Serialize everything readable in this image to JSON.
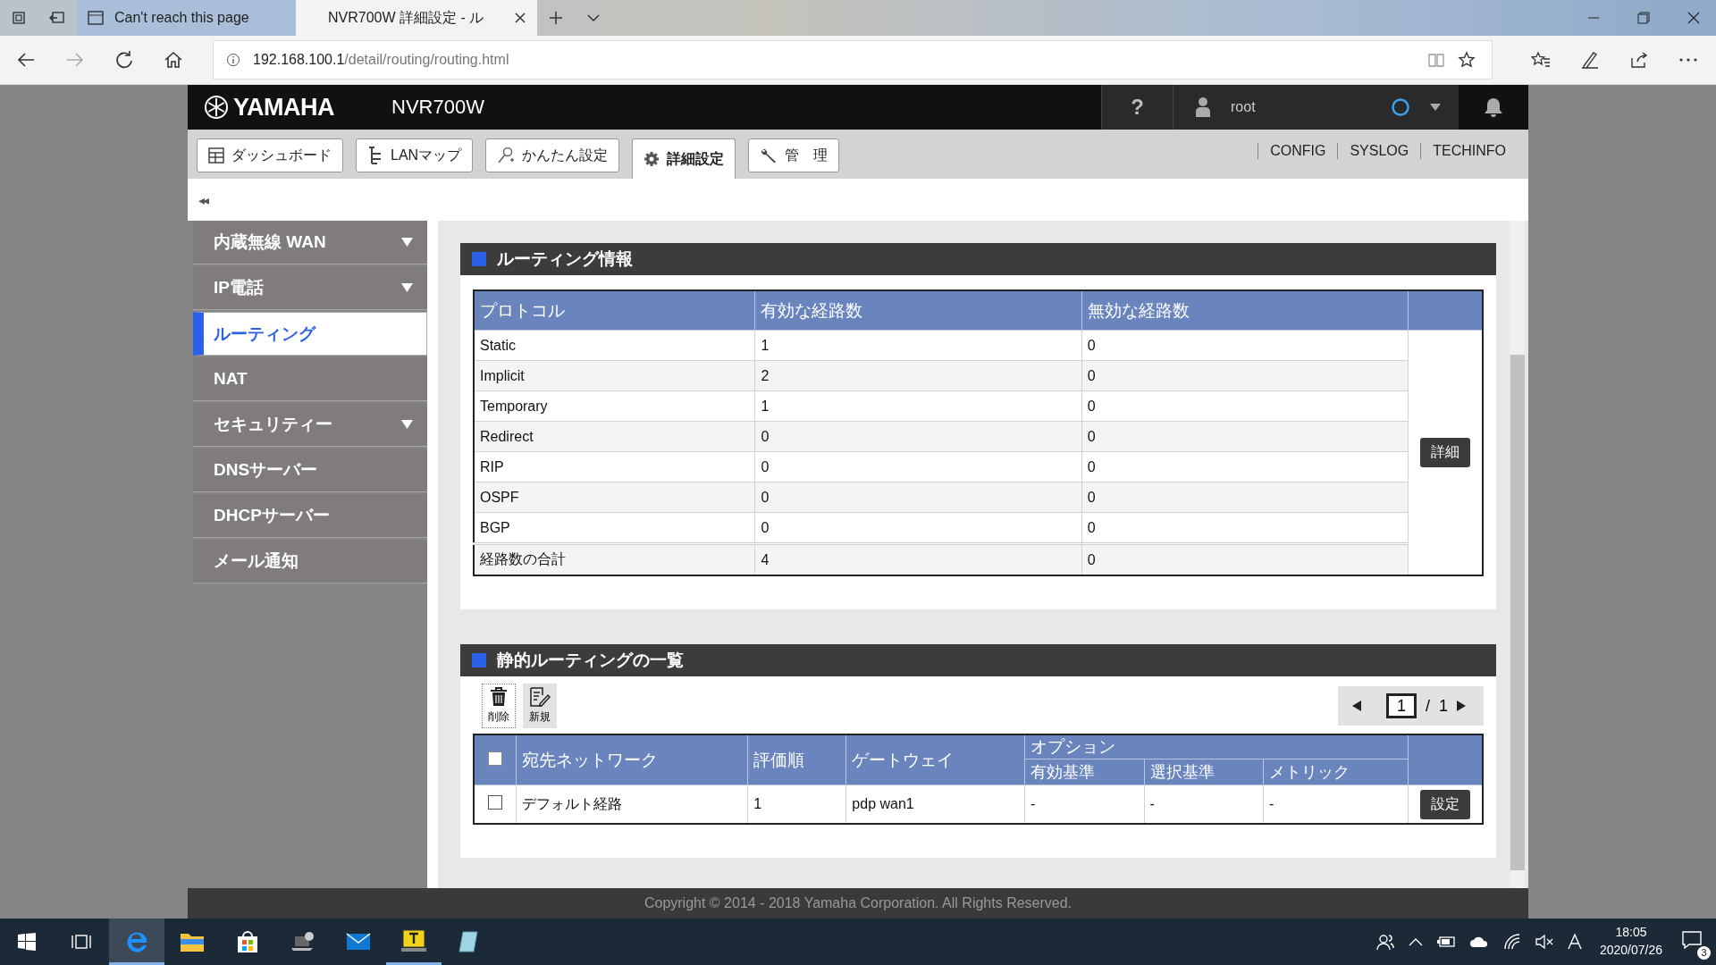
{
  "browser": {
    "tabs": [
      {
        "title": "Can't reach this page",
        "selected": false
      },
      {
        "title": "NVR700W 詳細設定 - ル",
        "selected": true
      }
    ],
    "url": {
      "host": "192.168.100.1",
      "path": "/detail/routing/routing.html"
    }
  },
  "header": {
    "logo": "YAMAHA",
    "model": "NVR700W",
    "help": "?",
    "user": "root"
  },
  "nav_tabs": [
    {
      "label": "ダッシュボード",
      "selected": false
    },
    {
      "label": "LANマップ",
      "selected": false
    },
    {
      "label": "かんたん設定",
      "selected": false
    },
    {
      "label": "詳細設定",
      "selected": true
    },
    {
      "label": "管　理",
      "selected": false
    }
  ],
  "top_links": [
    "CONFIG",
    "SYSLOG",
    "TECHINFO"
  ],
  "collapse": "◂◂",
  "sidebar": [
    {
      "label": "内蔵無線 WAN",
      "kind": "group",
      "selected": false
    },
    {
      "label": "IP電話",
      "kind": "group",
      "selected": false
    },
    {
      "label": "ルーティング",
      "kind": "link",
      "selected": true
    },
    {
      "label": "NAT",
      "kind": "link",
      "selected": false
    },
    {
      "label": "セキュリティー",
      "kind": "group",
      "selected": false
    },
    {
      "label": "DNSサーバー",
      "kind": "link",
      "selected": false
    },
    {
      "label": "DHCPサーバー",
      "kind": "link",
      "selected": false
    },
    {
      "label": "メール通知",
      "kind": "link",
      "selected": false
    }
  ],
  "routing_info": {
    "title": "ルーティング情報",
    "columns": [
      "プロトコル",
      "有効な経路数",
      "無効な経路数"
    ],
    "rows": [
      [
        "Static",
        "1",
        "0"
      ],
      [
        "Implicit",
        "2",
        "0"
      ],
      [
        "Temporary",
        "1",
        "0"
      ],
      [
        "Redirect",
        "0",
        "0"
      ],
      [
        "RIP",
        "0",
        "0"
      ],
      [
        "OSPF",
        "0",
        "0"
      ],
      [
        "BGP",
        "0",
        "0"
      ]
    ],
    "total": [
      "経路数の合計",
      "4",
      "0"
    ],
    "detail_button": "詳細"
  },
  "static_routes": {
    "title": "静的ルーティングの一覧",
    "toolbar": [
      {
        "label": "削除",
        "kind": "delete"
      },
      {
        "label": "新規",
        "kind": "new"
      }
    ],
    "pager": {
      "page": "1",
      "separator": "/",
      "total": "1"
    },
    "columns": {
      "destination": "宛先ネットワーク",
      "order": "評価順",
      "gateway": "ゲートウェイ",
      "options": "オプション",
      "option_columns": [
        "有効基準",
        "選択基準",
        "メトリック"
      ]
    },
    "all_checked": false,
    "rows": [
      {
        "checked": false,
        "destination": "デフォルト経路",
        "order": "1",
        "gateway": "pdp wan1",
        "options": [
          "-",
          "-",
          "-"
        ],
        "button": "設定"
      }
    ]
  },
  "footer": "Copyright © 2014 - 2018 Yamaha Corporation. All Rights Reserved.",
  "taskbar": {
    "time": "18:05",
    "date": "2020/07/26",
    "notifications": "3"
  }
}
